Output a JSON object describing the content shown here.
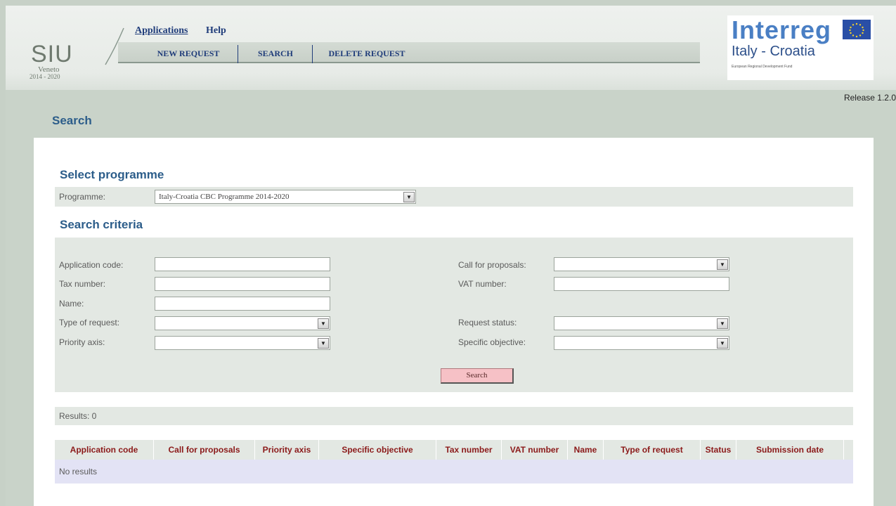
{
  "header": {
    "siu_title": "SIU",
    "siu_region": "Veneto",
    "siu_years": "2014 - 2020",
    "top_menu": [
      "Applications",
      "Help"
    ],
    "nav_tabs": [
      "NEW REQUEST",
      "SEARCH",
      "DELETE REQUEST"
    ],
    "interreg_word": "Interreg",
    "interreg_subtitle": "Italy - Croatia",
    "interreg_fund": "European Regional Development Fund",
    "release": "Release 1.2.0"
  },
  "page_title": "Search",
  "select_programme": {
    "title": "Select programme",
    "programme_label": "Programme:",
    "programme_value": "Italy-Croatia CBC Programme 2014-2020"
  },
  "search_criteria": {
    "title": "Search criteria",
    "application_code_label": "Application code:",
    "tax_number_label": "Tax number:",
    "name_label": "Name:",
    "type_of_request_label": "Type of request:",
    "priority_axis_label": "Priority axis:",
    "call_for_proposals_label": "Call for proposals:",
    "vat_number_label": "VAT number:",
    "request_status_label": "Request status:",
    "specific_objective_label": "Specific objective:",
    "search_button": "Search"
  },
  "results": {
    "count_label": "Results: 0",
    "columns": [
      "Application code",
      "Call for proposals",
      "Priority axis",
      "Specific objective",
      "Tax number",
      "VAT number",
      "Name",
      "Type of request",
      "Status",
      "Submission date"
    ],
    "empty_text": "No results"
  },
  "colors": {
    "accent_blue": "#2c5d8a",
    "header_red": "#8b1a1a",
    "panel_bg": "#e3e8e3",
    "search_button_bg": "#f6c1c6"
  }
}
